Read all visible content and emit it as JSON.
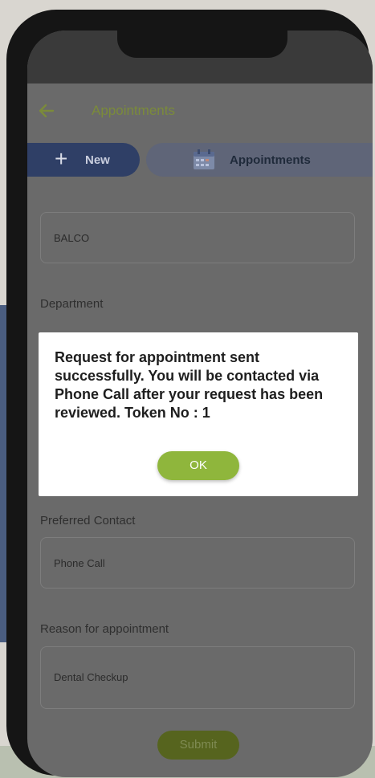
{
  "header": {
    "back_icon": "arrow-left-icon",
    "title": "Appointments"
  },
  "tabs": [
    {
      "label": "New",
      "icon": "plus-icon",
      "color": "#2f3f66"
    },
    {
      "label": "Appointments",
      "icon": "calendar-icon",
      "color": "#5f6578"
    }
  ],
  "form": {
    "hospital_value": "BALCO",
    "department_label": "Department",
    "preferred_contact_label": "Preferred Contact",
    "preferred_contact_value": "Phone Call",
    "reason_label": "Reason for appointment",
    "reason_value": "Dental Checkup",
    "submit_label": "Submit"
  },
  "dialog": {
    "message": "Request for appointment sent successfully. You will be contacted via Phone Call after your request has been reviewed. Token No : 1",
    "ok_label": "OK"
  },
  "colors": {
    "accent_green": "#8fb63c",
    "title_green": "#7b8b3a",
    "overlay": "#6a6a6a"
  }
}
